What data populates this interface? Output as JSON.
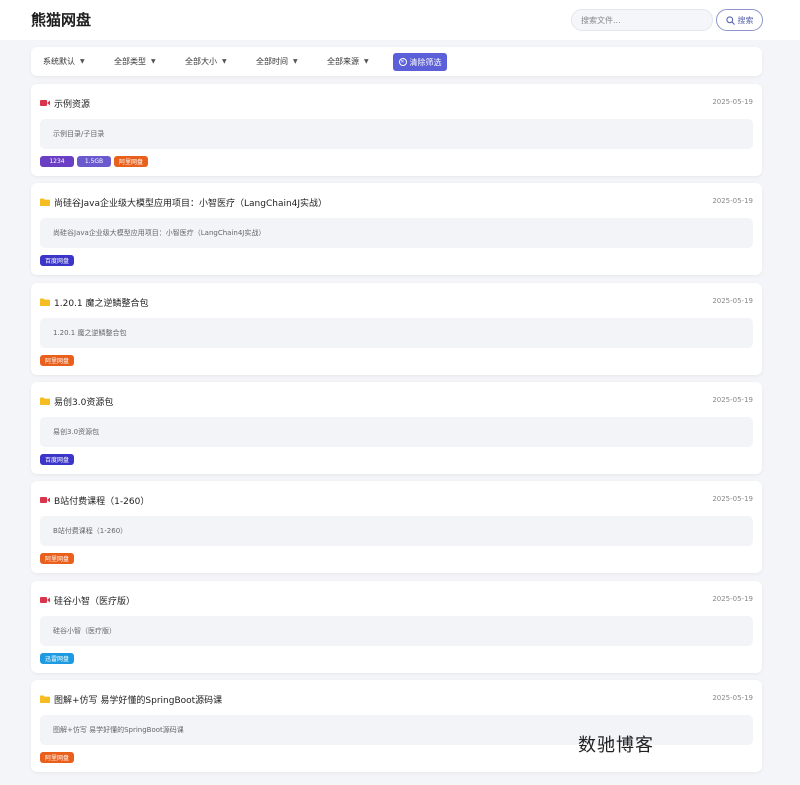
{
  "header": {
    "title": "熊猫网盘",
    "search_placeholder": "搜索文件...",
    "search_label": "搜索"
  },
  "filters": {
    "sort": "系统默认",
    "type": "全部类型",
    "size": "全部大小",
    "time": "全部时间",
    "source": "全部来源",
    "clear_label": "清除筛选"
  },
  "colors": {
    "accent": "#5b5fd8",
    "video_icon": "#d9344a",
    "folder_icon": "#f5bd21",
    "tag_count": "#6b3fc4",
    "tag_size": "#6a5acd",
    "tag_aliyun": "#e8601c",
    "tag_baidu": "#3b36c8",
    "tag_xunlei": "#1e9be0"
  },
  "items": [
    {
      "icon": "video-icon",
      "title": "示例资源",
      "date": "2025-05-19",
      "path": "示例目录/子目录",
      "tags": [
        {
          "label": "1234",
          "kind": "count"
        },
        {
          "label": "1.5GB",
          "kind": "size"
        },
        {
          "label": "阿里网盘",
          "kind": "aliyun"
        }
      ]
    },
    {
      "icon": "folder-icon",
      "title": "尚硅谷Java企业级大模型应用项目：小智医疗（LangChain4J实战）",
      "date": "2025-05-19",
      "path": "尚硅谷Java企业级大模型应用项目：小智医疗（LangChain4J实战）",
      "tags": [
        {
          "label": "百度网盘",
          "kind": "baidu"
        }
      ]
    },
    {
      "icon": "folder-icon",
      "title": "1.20.1 魔之逆鳞整合包",
      "date": "2025-05-19",
      "path": "1.20.1 魔之逆鳞整合包",
      "tags": [
        {
          "label": "阿里网盘",
          "kind": "aliyun"
        }
      ]
    },
    {
      "icon": "folder-icon",
      "title": "易创3.0资源包",
      "date": "2025-05-19",
      "path": "易创3.0资源包",
      "tags": [
        {
          "label": "百度网盘",
          "kind": "baidu"
        }
      ]
    },
    {
      "icon": "video-icon",
      "title": "B站付费课程（1-260）",
      "date": "2025-05-19",
      "path": "B站付费课程（1-260）",
      "tags": [
        {
          "label": "阿里网盘",
          "kind": "aliyun"
        }
      ]
    },
    {
      "icon": "video-icon",
      "title": "硅谷小智（医疗版）",
      "date": "2025-05-19",
      "path": "硅谷小智（医疗版）",
      "tags": [
        {
          "label": "迅雷网盘",
          "kind": "xunlei"
        }
      ]
    },
    {
      "icon": "folder-icon",
      "title": "图解+仿写 易学好懂的SpringBoot源码课",
      "date": "2025-05-19",
      "path": "图解+仿写 易学好懂的SpringBoot源码课",
      "tags": [
        {
          "label": "阿里网盘",
          "kind": "aliyun"
        }
      ]
    }
  ],
  "watermark": "数驰博客"
}
